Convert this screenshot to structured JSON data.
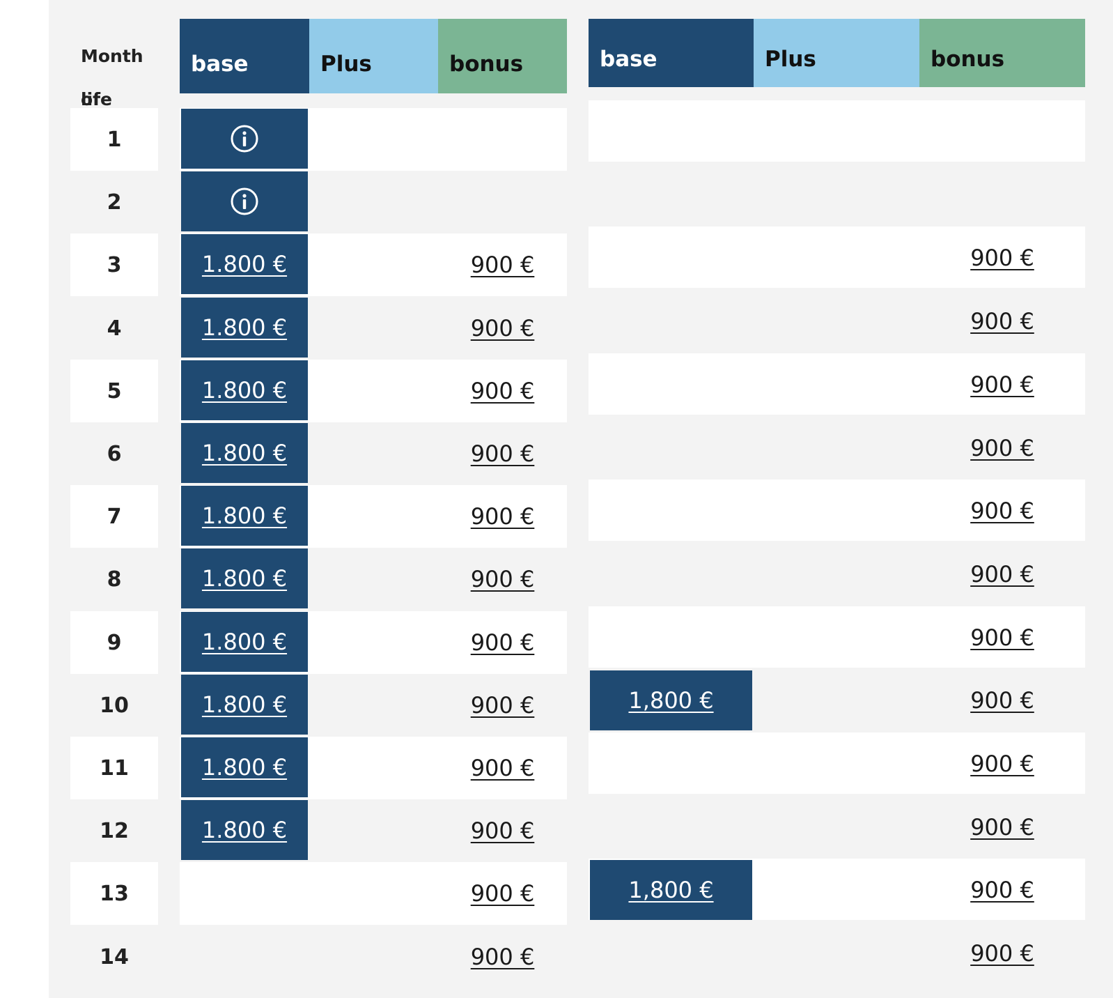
{
  "month_header": [
    "Month of",
    "life"
  ],
  "left_table": {
    "headers": {
      "base": "base",
      "plus": "Plus",
      "bonus": "bonus"
    },
    "rows": [
      {
        "month": "1",
        "base": "info-icon",
        "bonus": ""
      },
      {
        "month": "2",
        "base": "info-icon",
        "bonus": ""
      },
      {
        "month": "3",
        "base": "1.800 €",
        "bonus": "900 €"
      },
      {
        "month": "4",
        "base": "1.800 €",
        "bonus": "900 €"
      },
      {
        "month": "5",
        "base": "1.800 €",
        "bonus": "900 €"
      },
      {
        "month": "6",
        "base": "1.800 €",
        "bonus": "900 €"
      },
      {
        "month": "7",
        "base": "1.800 €",
        "bonus": "900 €"
      },
      {
        "month": "8",
        "base": "1.800 €",
        "bonus": "900 €"
      },
      {
        "month": "9",
        "base": "1.800 €",
        "bonus": "900 €"
      },
      {
        "month": "10",
        "base": "1.800 €",
        "bonus": "900 €"
      },
      {
        "month": "11",
        "base": "1.800 €",
        "bonus": "900 €"
      },
      {
        "month": "12",
        "base": "1.800 €",
        "bonus": "900 €"
      },
      {
        "month": "13",
        "base": "",
        "bonus": "900 €"
      },
      {
        "month": "14",
        "base": "",
        "bonus": "900 €"
      }
    ]
  },
  "right_table": {
    "headers": {
      "base": "base",
      "plus": "Plus",
      "bonus": "bonus"
    },
    "rows": [
      {
        "base": "",
        "bonus": ""
      },
      {
        "base": "",
        "bonus": ""
      },
      {
        "base": "",
        "bonus": "900 €"
      },
      {
        "base": "",
        "bonus": "900 €"
      },
      {
        "base": "",
        "bonus": "900 €"
      },
      {
        "base": "",
        "bonus": "900 €"
      },
      {
        "base": "",
        "bonus": "900 €"
      },
      {
        "base": "",
        "bonus": "900 €"
      },
      {
        "base": "",
        "bonus": "900 €"
      },
      {
        "base": "1,800 €",
        "bonus": "900 €"
      },
      {
        "base": "",
        "bonus": "900 €"
      },
      {
        "base": "",
        "bonus": "900 €"
      },
      {
        "base": "1,800 €",
        "bonus": "900 €"
      },
      {
        "base": "",
        "bonus": "900 €"
      }
    ]
  },
  "colors": {
    "base": "#1f4a72",
    "plus": "#92cbe9",
    "bonus": "#7bb594",
    "panel": "#f3f3f3",
    "row_white": "#ffffff"
  }
}
